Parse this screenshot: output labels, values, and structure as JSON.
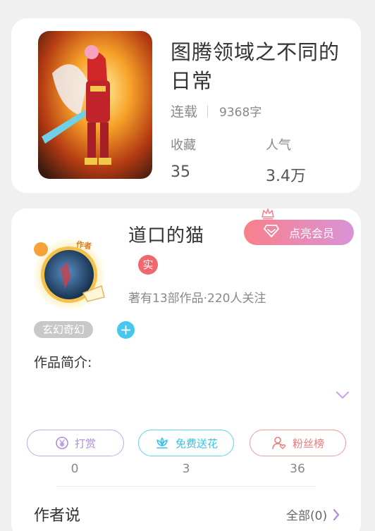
{
  "book": {
    "title": "图腾领域之不同的日常",
    "status": "连载",
    "word_count": "9368字",
    "favorites_label": "收藏",
    "favorites_value": "35",
    "popularity_label": "人气",
    "popularity_value": "3.4万"
  },
  "author": {
    "name": "道口的猫",
    "avatar_badge": "作者",
    "verified_badge": "实",
    "meta": "著有13部作品·220人关注",
    "vip_button": "点亮会员",
    "genre_tag": "玄幻奇幻",
    "add_tag": "+",
    "intro_label": "作品简介:"
  },
  "actions": [
    {
      "label": "打赏",
      "count": "0"
    },
    {
      "label": "免费送花",
      "count": "3"
    },
    {
      "label": "粉丝榜",
      "count": "36"
    }
  ],
  "author_says": {
    "title": "作者说",
    "all_link": "全部(0)"
  },
  "colors": {
    "vip_gradient_start": "#f8808a",
    "vip_gradient_end": "#d993d9",
    "tip": "#b08de0",
    "flower": "#39c0e6",
    "fans": "#ec7a7a",
    "add_tag": "#48c7ee",
    "verified": "#f0686d"
  }
}
